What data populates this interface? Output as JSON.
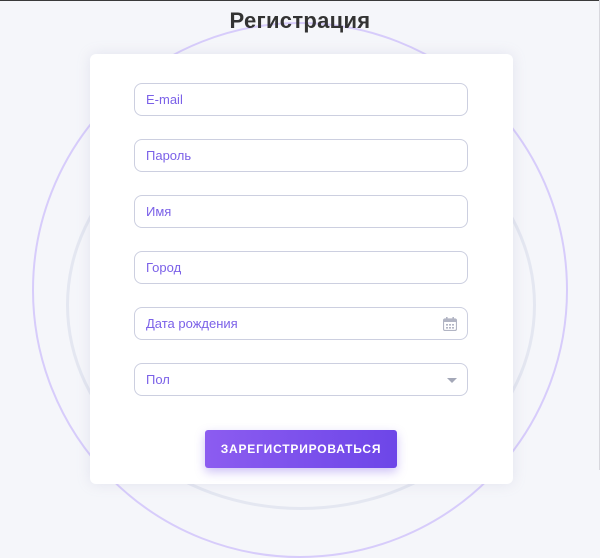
{
  "page": {
    "title": "Регистрация"
  },
  "form": {
    "fields": {
      "email": {
        "placeholder": "E-mail"
      },
      "password": {
        "placeholder": "Пароль"
      },
      "name": {
        "placeholder": "Имя"
      },
      "city": {
        "placeholder": "Город"
      },
      "birthdate": {
        "placeholder": "Дата рождения",
        "icon": "calendar-icon"
      },
      "gender": {
        "value": "Пол",
        "icon": "chevron-down-icon"
      }
    },
    "submit_label": "ЗАРЕГИСТРИРОВАТЬСЯ"
  },
  "colors": {
    "accent": "#7b61e8",
    "button_gradient_start": "#8c5cf0",
    "button_gradient_end": "#6d46e8",
    "field_border": "#cccfe0",
    "background": "#f5f6fa",
    "title_text": "#333333"
  }
}
